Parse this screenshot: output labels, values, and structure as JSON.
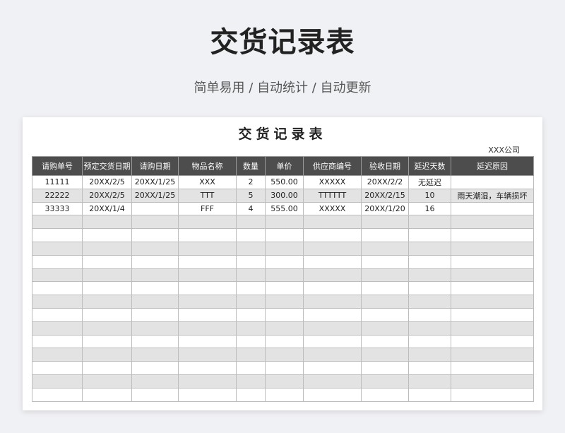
{
  "page": {
    "title": "交货记录表",
    "subtitle": "简单易用 / 自动统计 / 自动更新"
  },
  "sheet": {
    "title": "交货记录表",
    "company": "XXX公司",
    "headers": [
      "请购单号",
      "预定交货日期",
      "请购日期",
      "物品名称",
      "数量",
      "单价",
      "供应商编号",
      "验收日期",
      "延迟天数",
      "延迟原因"
    ],
    "rows": [
      [
        "11111",
        "20XX/2/5",
        "20XX/1/25",
        "XXX",
        "2",
        "550.00",
        "XXXXX",
        "20XX/2/2",
        "无延迟",
        ""
      ],
      [
        "22222",
        "20XX/2/5",
        "20XX/1/25",
        "TTT",
        "5",
        "300.00",
        "TTTTTT",
        "20XX/2/15",
        "10",
        "雨天潮湿，车辆损坏"
      ],
      [
        "33333",
        "20XX/1/4",
        "",
        "FFF",
        "4",
        "555.00",
        "XXXXX",
        "20XX/1/20",
        "16",
        ""
      ],
      [
        "",
        "",
        "",
        "",
        "",
        "",
        "",
        "",
        "",
        ""
      ],
      [
        "",
        "",
        "",
        "",
        "",
        "",
        "",
        "",
        "",
        ""
      ],
      [
        "",
        "",
        "",
        "",
        "",
        "",
        "",
        "",
        "",
        ""
      ],
      [
        "",
        "",
        "",
        "",
        "",
        "",
        "",
        "",
        "",
        ""
      ],
      [
        "",
        "",
        "",
        "",
        "",
        "",
        "",
        "",
        "",
        ""
      ],
      [
        "",
        "",
        "",
        "",
        "",
        "",
        "",
        "",
        "",
        ""
      ],
      [
        "",
        "",
        "",
        "",
        "",
        "",
        "",
        "",
        "",
        ""
      ],
      [
        "",
        "",
        "",
        "",
        "",
        "",
        "",
        "",
        "",
        ""
      ],
      [
        "",
        "",
        "",
        "",
        "",
        "",
        "",
        "",
        "",
        ""
      ],
      [
        "",
        "",
        "",
        "",
        "",
        "",
        "",
        "",
        "",
        ""
      ],
      [
        "",
        "",
        "",
        "",
        "",
        "",
        "",
        "",
        "",
        ""
      ],
      [
        "",
        "",
        "",
        "",
        "",
        "",
        "",
        "",
        "",
        ""
      ],
      [
        "",
        "",
        "",
        "",
        "",
        "",
        "",
        "",
        "",
        ""
      ],
      [
        "",
        "",
        "",
        "",
        "",
        "",
        "",
        "",
        "",
        ""
      ]
    ]
  },
  "colors": {
    "header_bg": "#4d4d4d",
    "stripe_bg": "#e3e3e3",
    "page_bg": "#f0f1f4"
  }
}
